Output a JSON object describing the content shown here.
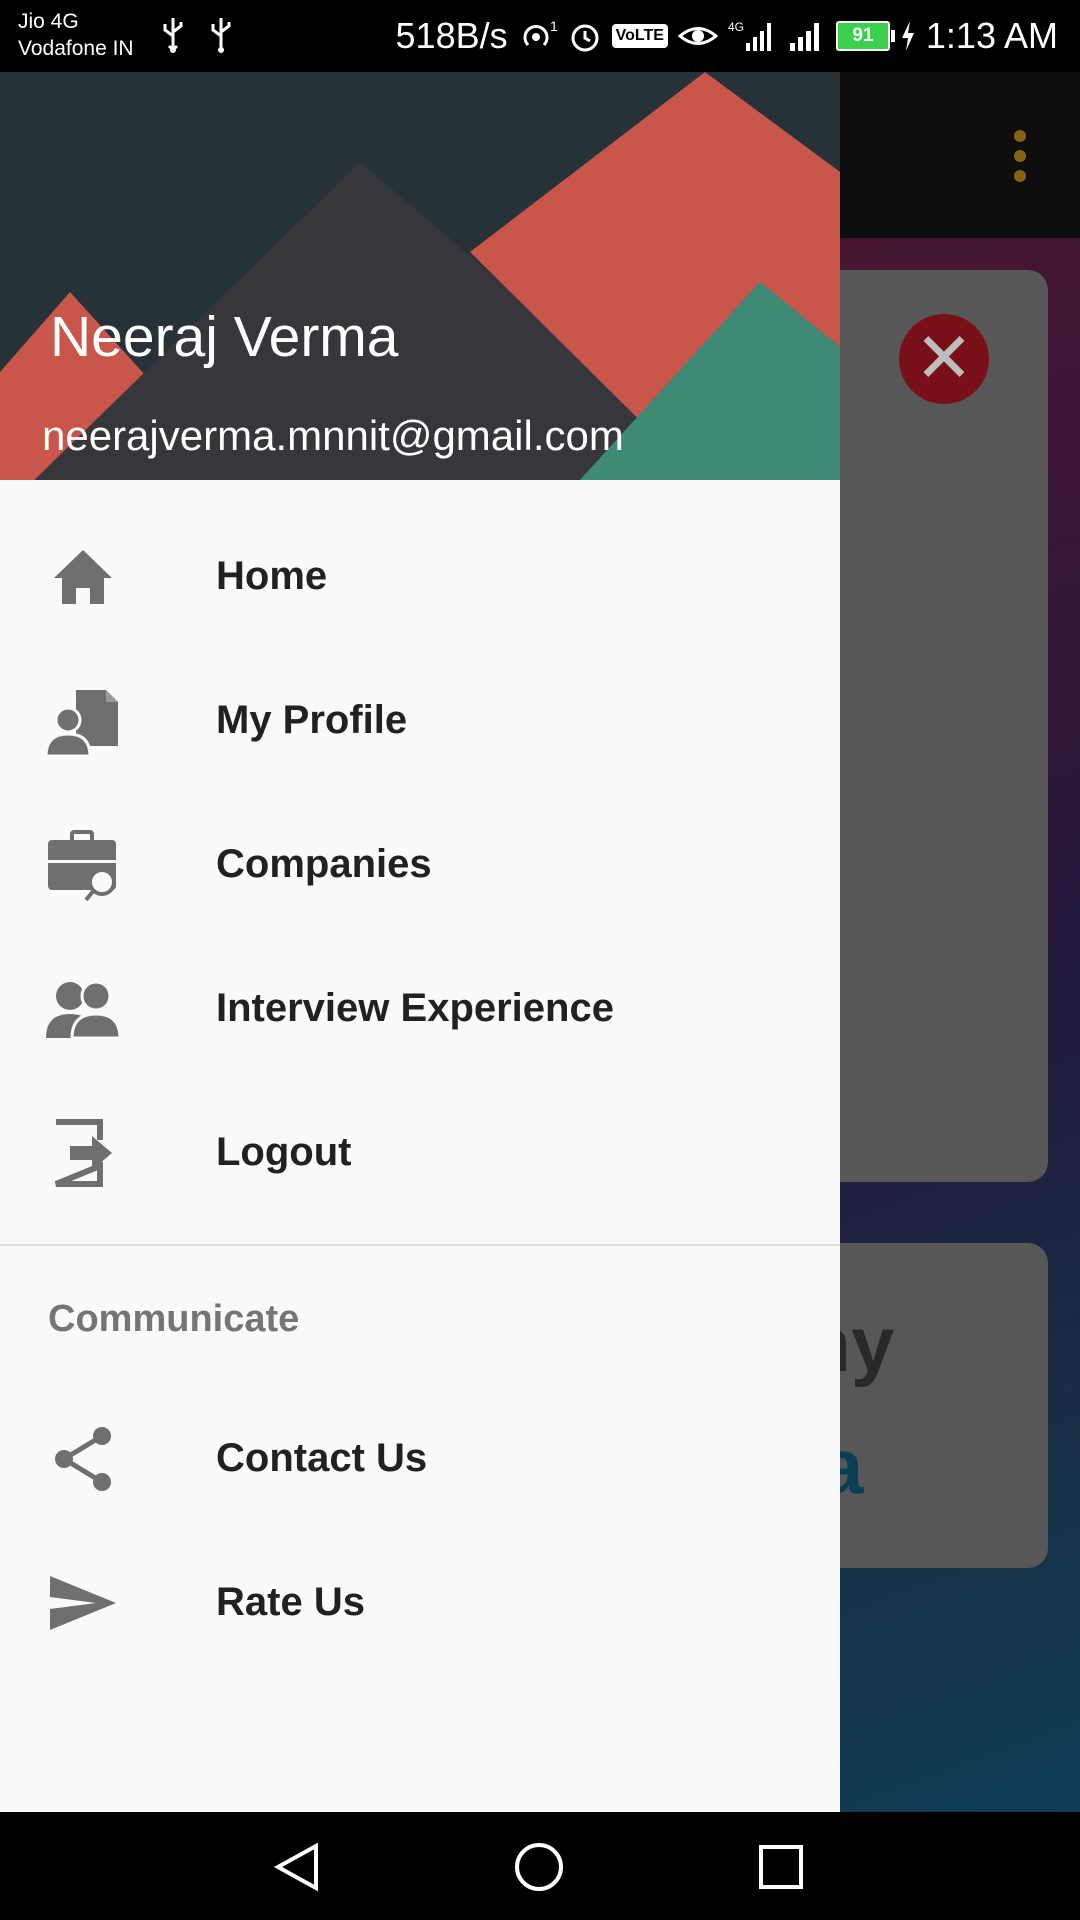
{
  "status_bar": {
    "carrier_line1": "Jio 4G",
    "carrier_line2": "Vodafone IN",
    "net_speed": "518B/s",
    "volte": "VoLTE",
    "battery": "91",
    "time": "1:13 AM",
    "icons": [
      "usb-icon",
      "usb-icon",
      "hotspot-icon",
      "alarm-icon",
      "volte-icon",
      "eye-icon",
      "signal-4g-icon",
      "signal-icon",
      "battery-icon",
      "charging-icon"
    ]
  },
  "drawer": {
    "user_name": "Neeraj Verma",
    "user_email": "neerajverma.mnnit@gmail.com",
    "menu": [
      {
        "label": "Home",
        "icon": "home-icon"
      },
      {
        "label": "My Profile",
        "icon": "profile-icon"
      },
      {
        "label": "Companies",
        "icon": "companies-icon"
      },
      {
        "label": "Interview Experience",
        "icon": "interview-icon"
      },
      {
        "label": "Logout",
        "icon": "logout-icon"
      }
    ],
    "section_title": "Communicate",
    "communicate_menu": [
      {
        "label": "Contact Us",
        "icon": "share-icon"
      },
      {
        "label": "Rate Us",
        "icon": "send-icon"
      }
    ]
  },
  "background_app": {
    "card_text_line1": "any",
    "card_text_line2": "a"
  },
  "colors": {
    "header_dark": "#263238",
    "mountain_red": "#c9564a",
    "mountain_dark": "#37363b",
    "mountain_green": "#3f8a76",
    "drawer_bg": "#fafafa",
    "menu_text": "#212121",
    "section_text": "#757575"
  }
}
